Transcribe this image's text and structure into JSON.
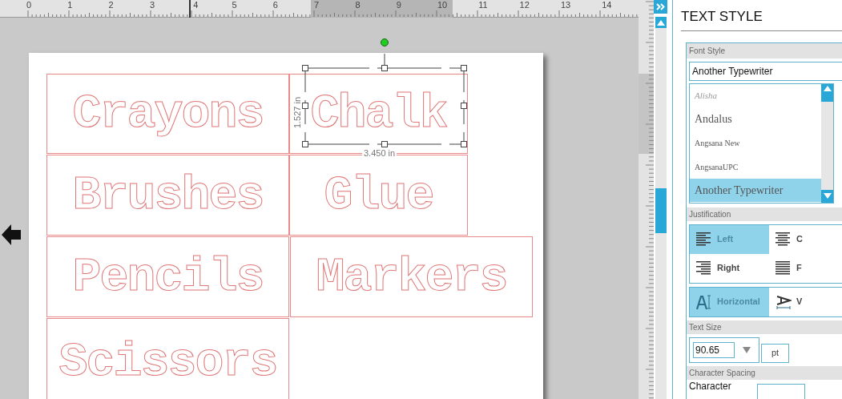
{
  "ruler": {
    "labels": [
      "0",
      "1",
      "2",
      "3",
      "4",
      "5",
      "6",
      "7",
      "8",
      "9",
      "10",
      "11",
      "12",
      "13",
      "14"
    ]
  },
  "canvas": {
    "labels": [
      {
        "text": "Crayons",
        "selected": false
      },
      {
        "text": "Chalk",
        "selected": true
      },
      {
        "text": "Brushes",
        "selected": false
      },
      {
        "text": "Glue",
        "selected": false
      },
      {
        "text": "Pencils",
        "selected": false
      },
      {
        "text": "Markers",
        "selected": false
      },
      {
        "text": "Scissors",
        "selected": false
      }
    ],
    "height_dimension": "1.527 in",
    "width_dimension": "3.450 in"
  },
  "panel": {
    "title": "TEXT STYLE",
    "font_style": {
      "heading": "Font Style",
      "value": "Another Typewriter",
      "fonts": [
        {
          "name": "Alisha",
          "selected": false
        },
        {
          "name": "Andalus",
          "selected": false
        },
        {
          "name": "Angsana New",
          "selected": false
        },
        {
          "name": "AngsanaUPC",
          "selected": false
        },
        {
          "name": "Another Typewriter",
          "selected": true
        }
      ]
    },
    "justification": {
      "heading": "Justification",
      "options": [
        {
          "kind": "left",
          "label": "Left",
          "selected": true
        },
        {
          "kind": "center",
          "label": "C",
          "selected": false
        },
        {
          "kind": "right",
          "label": "Right",
          "selected": false
        },
        {
          "kind": "full",
          "label": "F",
          "selected": false
        }
      ],
      "directions": [
        {
          "kind": "horizontal",
          "label": "Horizontal",
          "selected": true
        },
        {
          "kind": "vertical",
          "label": "V",
          "selected": false
        }
      ]
    },
    "text_size": {
      "heading": "Text Size",
      "value": "90.65",
      "unit": "pt"
    },
    "character_spacing": {
      "heading": "Character Spacing",
      "label": "Character"
    }
  }
}
